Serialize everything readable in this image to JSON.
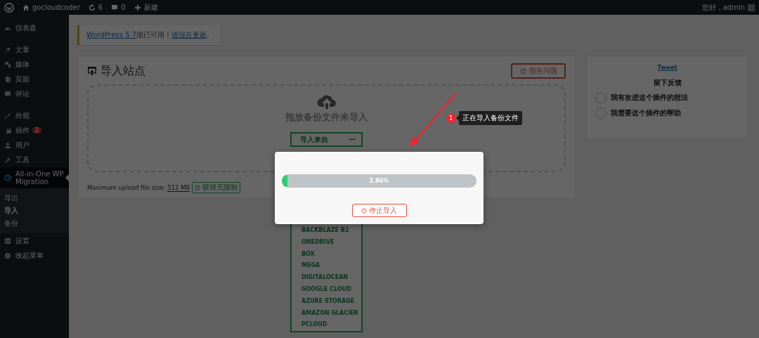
{
  "admin_bar": {
    "site": "gocloudcoder",
    "updates": "6",
    "comments": "0",
    "new": "新建",
    "greeting": "您好，admin"
  },
  "sidebar": {
    "groups": [
      [
        {
          "label": "仪表盘",
          "selected": false
        }
      ],
      [
        {
          "label": "文章",
          "selected": false
        },
        {
          "label": "媒体",
          "selected": false
        },
        {
          "label": "页面",
          "selected": false
        },
        {
          "label": "评论",
          "selected": false
        }
      ],
      [
        {
          "label": "外观",
          "selected": false
        },
        {
          "label": "插件",
          "selected": false,
          "badge": "2"
        },
        {
          "label": "用户",
          "selected": false
        },
        {
          "label": "工具",
          "selected": false
        },
        {
          "label": "All-in-One WP Migration",
          "selected": true,
          "expanded": true,
          "children": [
            {
              "label": "导出",
              "selected": false
            },
            {
              "label": "导入",
              "selected": true
            },
            {
              "label": "备份",
              "selected": false
            }
          ]
        },
        {
          "label": "设置",
          "selected": false
        },
        {
          "label": "收起菜单",
          "selected": false
        }
      ]
    ]
  },
  "notice": {
    "parts": [
      {
        "kind": "link",
        "text": "WordPress 5.7"
      },
      {
        "kind": "text",
        "text": "现已可用！"
      },
      {
        "kind": "link",
        "text": "请现在更新"
      },
      {
        "kind": "text",
        "text": "。"
      }
    ]
  },
  "import_panel": {
    "title": "导入站点",
    "report_button": "报告问题",
    "drop_text": "拖放备份文件来导入",
    "import_from": {
      "label": "导入来自",
      "expanded": true,
      "options": [
        "BACKBLAZE B2",
        "ONEDRIVE",
        "BOX",
        "MEGA",
        "DIGITALOCEAN",
        "GOOGLE CLOUD",
        "AZURE STORAGE",
        "AMAZON GLACIER",
        "PCLOUD"
      ]
    },
    "max_upload": {
      "label": "Maximum upload file size:",
      "value": "512 MB",
      "button": "获得无限制"
    }
  },
  "feedback": {
    "tweet": "Tweet",
    "title": "留下反馈",
    "options": [
      {
        "label": "我有改进这个插件的想法",
        "selected": false
      },
      {
        "label": "我需要这个插件的帮助",
        "selected": false
      }
    ]
  },
  "modal": {
    "level": 0.0296,
    "reading": "2.96%",
    "stop_button": "停止导入"
  },
  "callout": {
    "number": "1",
    "text": "正在导入备份文件"
  }
}
